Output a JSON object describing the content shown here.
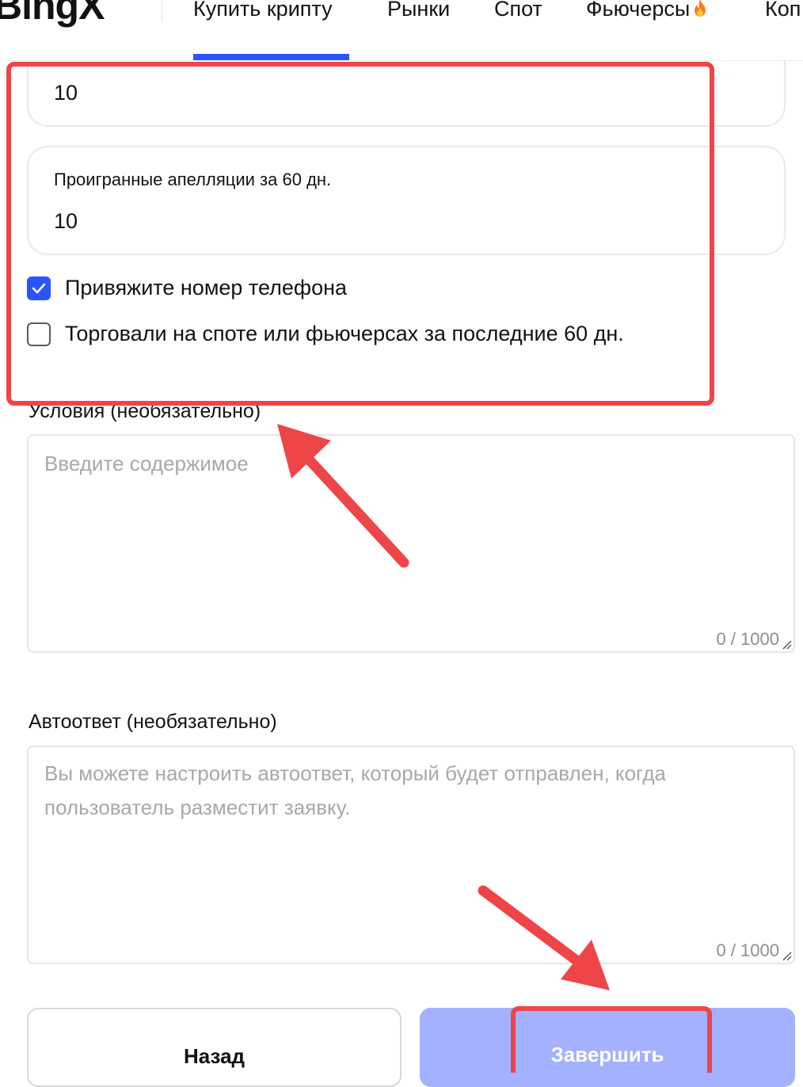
{
  "nav": {
    "logo": "BingX",
    "items": [
      "Купить крипту",
      "Рынки",
      "Спот",
      "Фьючерсы",
      "Коп"
    ],
    "active_index": 0,
    "hot_icon": "fire-icon"
  },
  "form": {
    "top_field_value": "10",
    "lost_appeals": {
      "label": "Проигранные апелляции за 60 дн.",
      "value": "10"
    },
    "checkboxes": [
      {
        "label": "Привяжите номер телефона",
        "checked": true
      },
      {
        "label": "Торговали на споте или фьючерсах за последние 60 дн.",
        "checked": false
      }
    ],
    "terms": {
      "label": "Условия (необязательно)",
      "placeholder": "Введите содержимое",
      "counter": "0 / 1000"
    },
    "autoreply": {
      "label": "Автоответ (необязательно)",
      "placeholder": "Вы можете настроить автоответ, который будет отправлен, когда пользователь разместит заявку.",
      "counter": "0 / 1000"
    }
  },
  "buttons": {
    "back_label": "Назад",
    "finish_label": "Завершить"
  },
  "colors": {
    "accent": "#2a54ff",
    "finish_disabled": "#a3b1ff",
    "annotation": "#ee4548"
  }
}
